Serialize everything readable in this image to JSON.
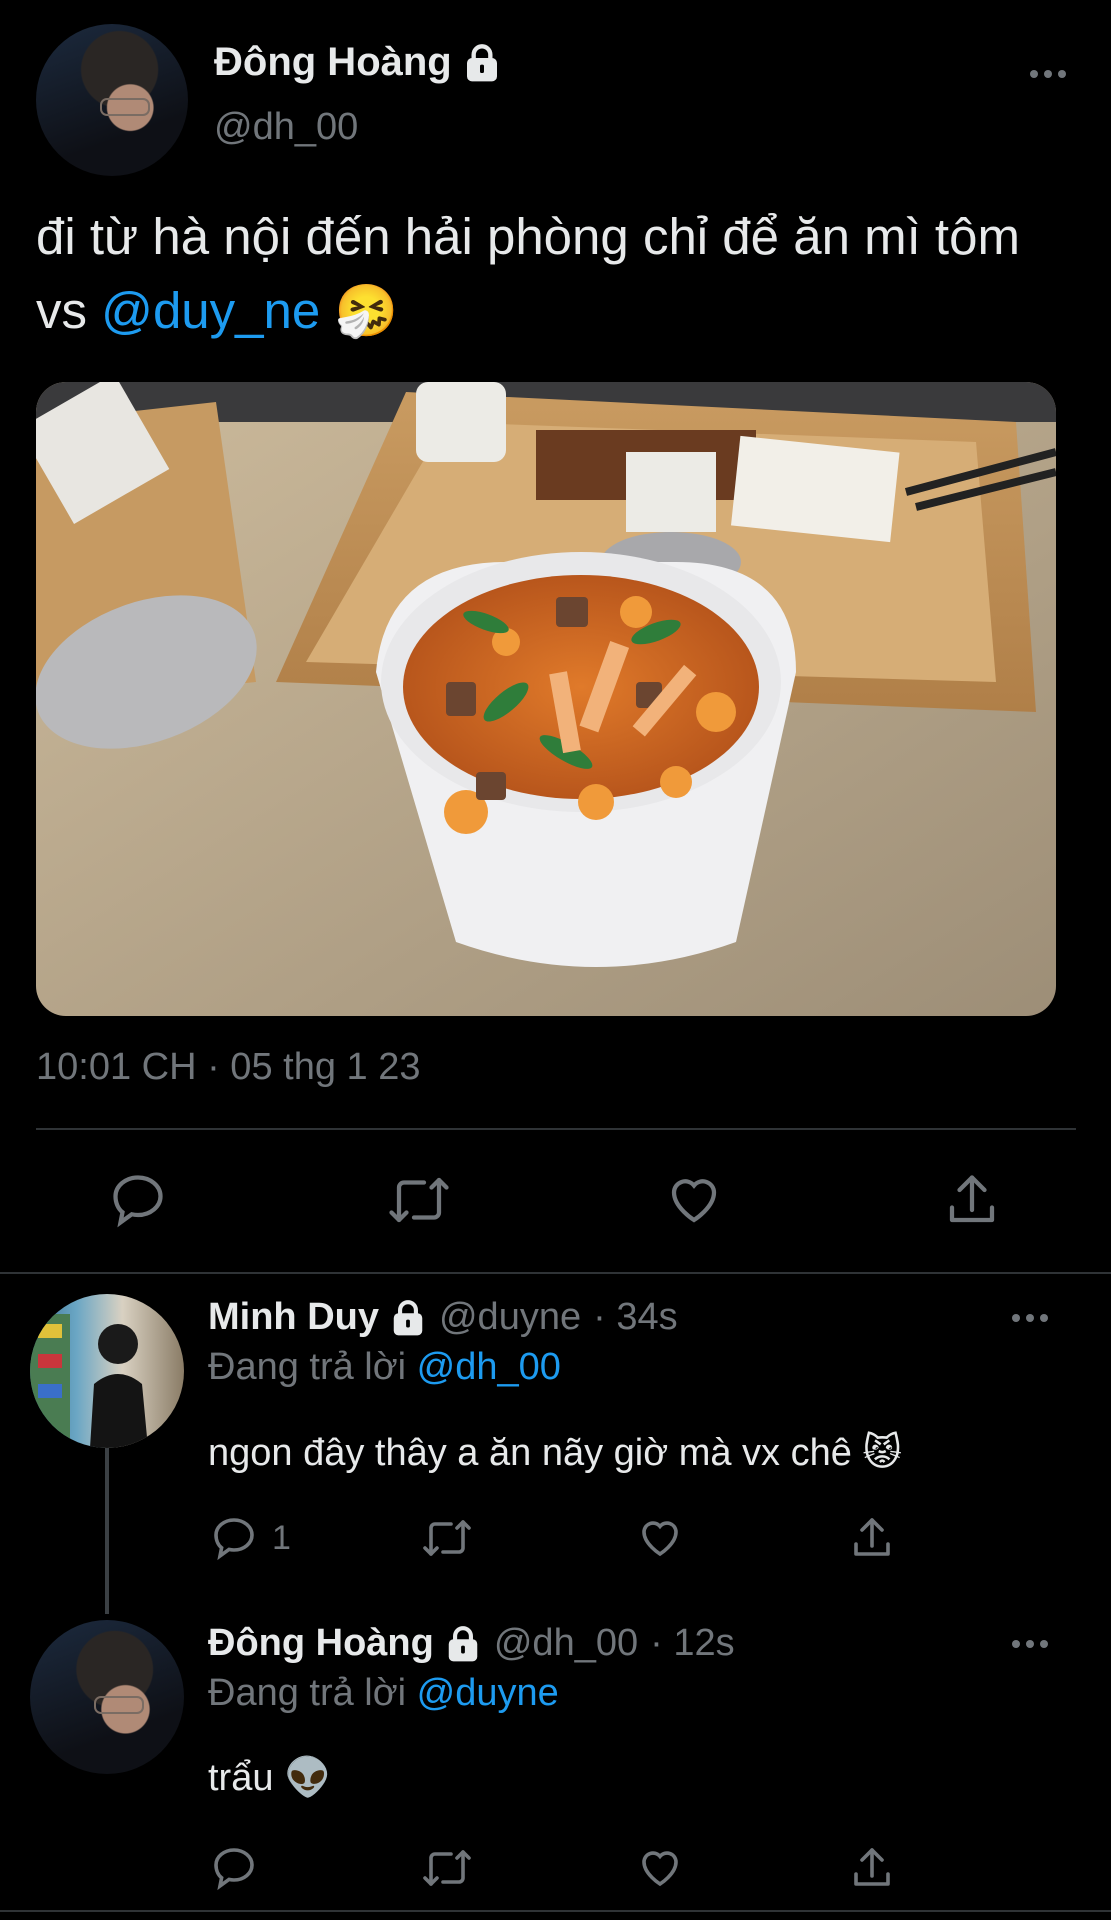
{
  "main_tweet": {
    "display_name": "Đông Hoàng",
    "handle": "@dh_00",
    "text_before": "đi từ hà nội đến hải phòng chỉ để ăn mì tôm vs ",
    "mention": "@duy_ne",
    "emoji": "🤧",
    "timestamp": "10:01 CH · 05 thg 1 23",
    "media_icons": [
      "lock-icon"
    ],
    "actions": [
      "reply-icon",
      "retweet-icon",
      "like-icon",
      "share-icon"
    ]
  },
  "replies": [
    {
      "display_name": "Minh Duy",
      "handle": "@duyne",
      "time": "· 34s",
      "replying_prefix": "Đang trả lời ",
      "replying_to": "@dh_00",
      "text": "ngon đây thây a ăn nãy giờ mà vx chê 😾",
      "reply_count": "1"
    },
    {
      "display_name": "Đông Hoàng",
      "handle": "@dh_00",
      "time": "· 12s",
      "replying_prefix": "Đang trả lời ",
      "replying_to": "@duyne",
      "text": "trẩu 👽",
      "reply_count": ""
    }
  ],
  "colors": {
    "background": "#000000",
    "text": "#e7e9ea",
    "muted": "#71767b",
    "link": "#1d9bf0",
    "divider": "#2f3336"
  }
}
